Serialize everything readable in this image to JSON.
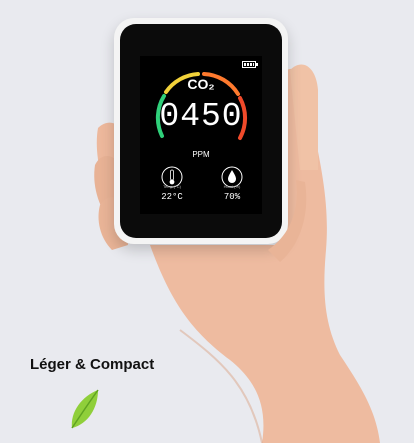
{
  "caption": "Léger & Compact",
  "device": {
    "gas_label": "CO₂",
    "reading": "0450",
    "unit": "PPM",
    "temperature": {
      "label": "Temp (°C)",
      "value": "22°C"
    },
    "humidity": {
      "label": "Humi (%)",
      "value": "70%"
    },
    "battery_icon": "battery-full-icon",
    "gauge_colors": [
      "#2fd07a",
      "#f2d23a",
      "#ff7a2e",
      "#f04a2a"
    ]
  },
  "decor": {
    "leaf_icon": "leaf-icon",
    "leaf_color": "#8fcf3a"
  }
}
